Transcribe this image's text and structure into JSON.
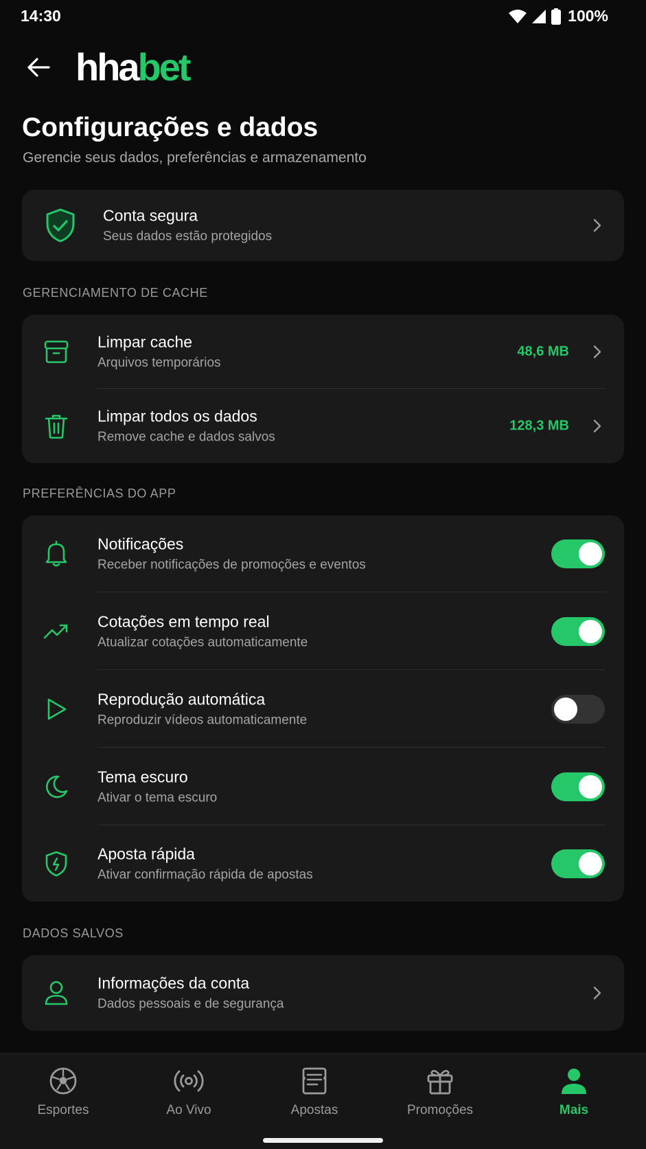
{
  "status_bar": {
    "time": "14:30",
    "battery": "100%"
  },
  "header": {
    "logo_white": "hha",
    "logo_green": "bet"
  },
  "page": {
    "title": "Configurações e dados",
    "subtitle": "Gerencie seus dados, preferências e armazenamento"
  },
  "security_card": {
    "title": "Conta segura",
    "subtitle": "Seus dados estão protegidos"
  },
  "cache_section": {
    "label": "GERENCIAMENTO DE CACHE",
    "items": [
      {
        "title": "Limpar cache",
        "subtitle": "Arquivos temporários",
        "value": "48,6 MB",
        "icon": "archive-box-icon"
      },
      {
        "title": "Limpar todos os dados",
        "subtitle": "Remove cache e dados salvos",
        "value": "128,3 MB",
        "icon": "trash-icon"
      }
    ]
  },
  "prefs_section": {
    "label": "PREFERÊNCIAS DO APP",
    "items": [
      {
        "title": "Notificações",
        "subtitle": "Receber notificações de promoções e eventos",
        "enabled": true,
        "icon": "bell-icon"
      },
      {
        "title": "Cotações em tempo real",
        "subtitle": "Atualizar cotações automaticamente",
        "enabled": true,
        "icon": "trend-up-icon"
      },
      {
        "title": "Reprodução automática",
        "subtitle": "Reproduzir vídeos automaticamente",
        "enabled": false,
        "icon": "play-icon"
      },
      {
        "title": "Tema escuro",
        "subtitle": "Ativar o tema escuro",
        "enabled": true,
        "icon": "moon-icon"
      },
      {
        "title": "Aposta rápida",
        "subtitle": "Ativar confirmação rápida de apostas",
        "enabled": true,
        "icon": "shield-bolt-icon"
      }
    ]
  },
  "saved_section": {
    "label": "DADOS SALVOS",
    "items": [
      {
        "title": "Informações da conta",
        "subtitle": "Dados pessoais e de segurança",
        "icon": "user-icon"
      }
    ]
  },
  "bottom_nav": {
    "items": [
      {
        "label": "Esportes",
        "icon": "soccer-ball-icon",
        "active": false
      },
      {
        "label": "Ao Vivo",
        "icon": "broadcast-icon",
        "active": false
      },
      {
        "label": "Apostas",
        "icon": "bet-slip-icon",
        "active": false
      },
      {
        "label": "Promoções",
        "icon": "gift-icon",
        "active": false
      },
      {
        "label": "Mais",
        "icon": "person-icon",
        "active": true
      }
    ]
  },
  "colors": {
    "accent": "#25c768",
    "background": "#0b0b0b",
    "card": "#1a1a1a"
  }
}
